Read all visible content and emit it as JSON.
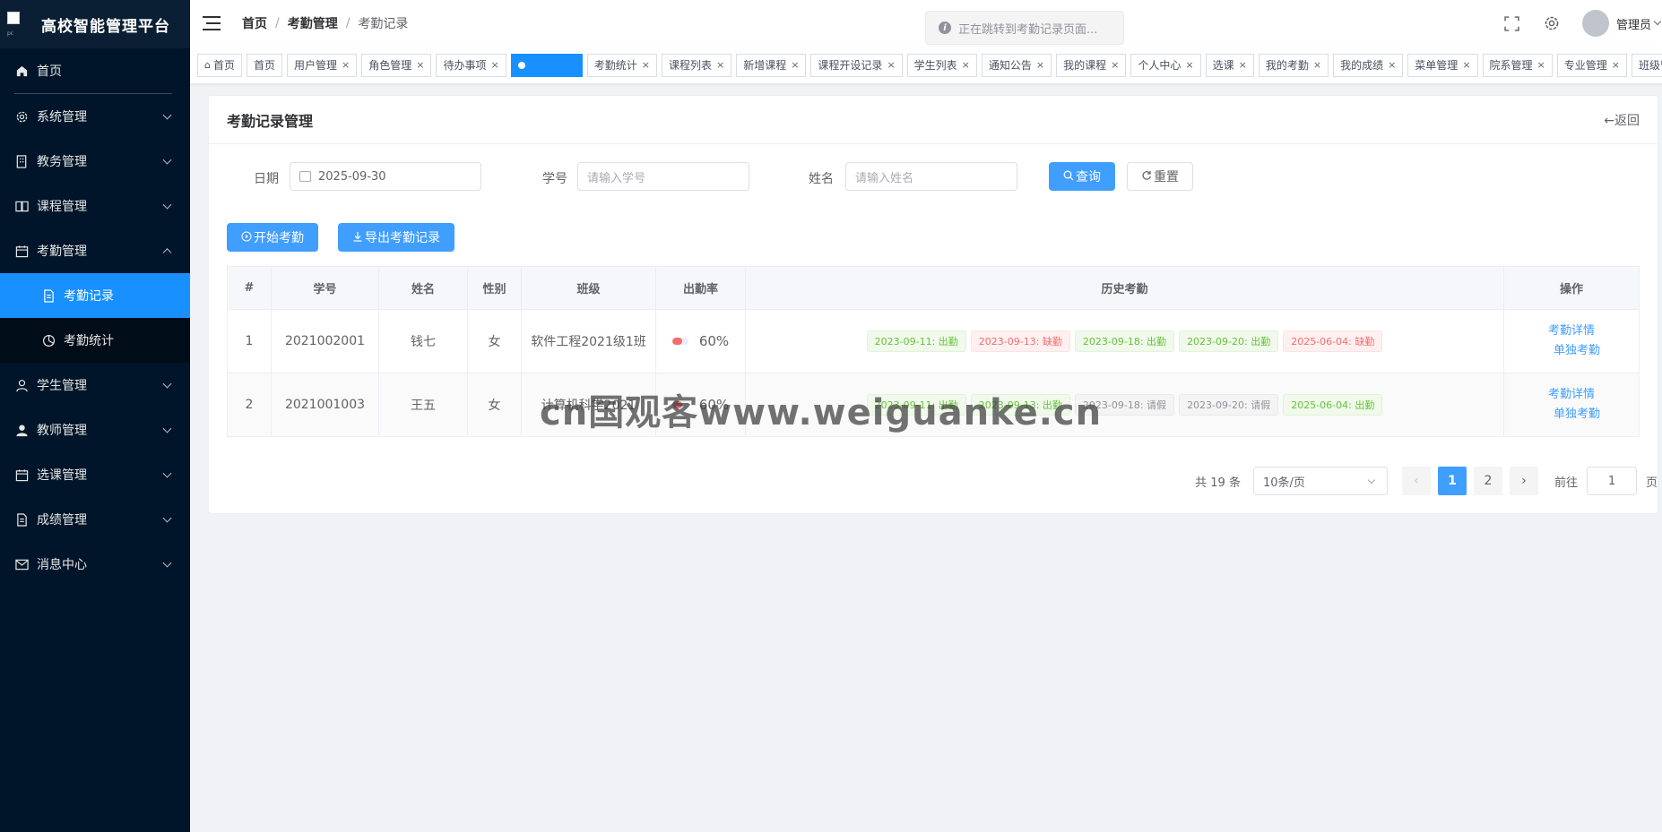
{
  "app": {
    "title": "高校智能管理平台",
    "logo_text": "pc"
  },
  "sidebar": {
    "items": [
      {
        "label": "首页",
        "icon": "home-icon"
      },
      {
        "label": "系统管理",
        "icon": "gear-icon"
      },
      {
        "label": "教务管理",
        "icon": "building-icon"
      },
      {
        "label": "课程管理",
        "icon": "book-icon"
      },
      {
        "label": "考勤管理",
        "icon": "calendar-icon"
      },
      {
        "label": "学生管理",
        "icon": "user-icon"
      },
      {
        "label": "教师管理",
        "icon": "user-filled-icon"
      },
      {
        "label": "选课管理",
        "icon": "calendar-icon"
      },
      {
        "label": "成绩管理",
        "icon": "document-icon"
      },
      {
        "label": "消息中心",
        "icon": "mail-icon"
      }
    ],
    "sub_items": [
      {
        "label": "考勤记录",
        "icon": "document-icon",
        "active": true
      },
      {
        "label": "考勤统计",
        "icon": "pie-chart-icon",
        "active": false
      }
    ]
  },
  "header": {
    "breadcrumb": [
      "首页",
      "考勤管理",
      "考勤记录"
    ],
    "separator": "/",
    "toast": "正在跳转到考勤记录页面...",
    "user_name": "管理员"
  },
  "tags": {
    "home": "首页",
    "items": [
      "首页",
      "用户管理",
      "角色管理",
      "待办事项",
      "",
      "考勤统计",
      "课程列表",
      "新增课程",
      "课程开设记录",
      "学生列表",
      "通知公告",
      "我的课程",
      "个人中心",
      "选课",
      "我的考勤",
      "我的成绩",
      "菜单管理",
      "院系管理",
      "专业管理",
      "班级管理"
    ],
    "close": "×"
  },
  "card": {
    "title": "考勤记录管理",
    "back": "←返回"
  },
  "form": {
    "date_label": "日期",
    "date_value": "2025-09-30",
    "student_id_label": "学号",
    "student_id_placeholder": "请输入学号",
    "name_label": "姓名",
    "name_placeholder": "请输入姓名",
    "search_button": "查询",
    "reset_button": "重置"
  },
  "actions": {
    "start_button": "开始考勤",
    "export_button": "导出考勤记录"
  },
  "table": {
    "columns": [
      "#",
      "学号",
      "姓名",
      "性别",
      "班级",
      "出勤率",
      "历史考勤",
      "操作"
    ],
    "rows": [
      {
        "index": "1",
        "student_id": "2021002001",
        "name": "钱七",
        "gender": "女",
        "class": "软件工程2021级1班",
        "rate_text": "60%",
        "rate": 0.6,
        "history": [
          {
            "text": "2023-09-11: 出勤",
            "status": "ok"
          },
          {
            "text": "2023-09-13: 缺勤",
            "status": "bad"
          },
          {
            "text": "2023-09-18: 出勤",
            "status": "ok"
          },
          {
            "text": "2023-09-20: 出勤",
            "status": "ok"
          },
          {
            "text": "2025-06-04: 缺勤",
            "status": "bad"
          }
        ],
        "op_detail": "考勤详情",
        "op_single": "单独考勤"
      },
      {
        "index": "2",
        "student_id": "2021001003",
        "name": "王五",
        "gender": "女",
        "class": "计算机科学2021",
        "rate_text": "60%",
        "rate": 0.6,
        "history": [
          {
            "text": "2023-09-11: 出勤",
            "status": "ok"
          },
          {
            "text": "2023-09-13: 出勤",
            "status": "ok"
          },
          {
            "text": "2023-09-18: 请假",
            "status": "leave"
          },
          {
            "text": "2023-09-20: 请假",
            "status": "leave"
          },
          {
            "text": "2025-06-04: 出勤",
            "status": "ok"
          }
        ],
        "op_detail": "考勤详情",
        "op_single": "单独考勤"
      }
    ]
  },
  "pagination": {
    "total": "共 19 条",
    "page_size": "10条/页",
    "pages": [
      "1",
      "2"
    ],
    "current": "1",
    "goto_prefix": "前往",
    "goto_value": "1",
    "goto_suffix": "页",
    "prev": "‹",
    "next": "›"
  },
  "watermark": "cn国观客www.weiguanke.cn",
  "colors": {
    "primary": "#409eff",
    "sidebar_bg": "#001529",
    "active_menu": "#1890ff"
  }
}
